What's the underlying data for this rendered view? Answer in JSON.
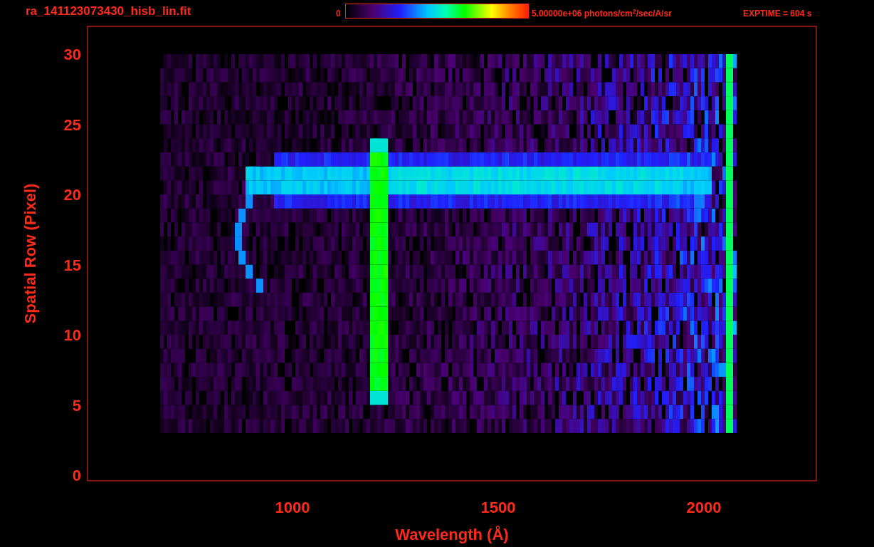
{
  "header": {
    "file_name": "ra_141123073430_hisb_lin.fit",
    "colorbar_min": "0",
    "colorbar_max": "5.00000e+06 photons/cm$^{2}$/sec/A/sr",
    "exposure": "EXPTIME = 604 s"
  },
  "plot": {
    "xlabel": "Wavelength (Å)",
    "ylabel": "Spatial Row (Pixel)",
    "xticks": [
      "1000",
      "1500",
      "2000"
    ],
    "yticks": [
      "30",
      "25",
      "20",
      "15",
      "10",
      "5",
      "0"
    ]
  }
}
